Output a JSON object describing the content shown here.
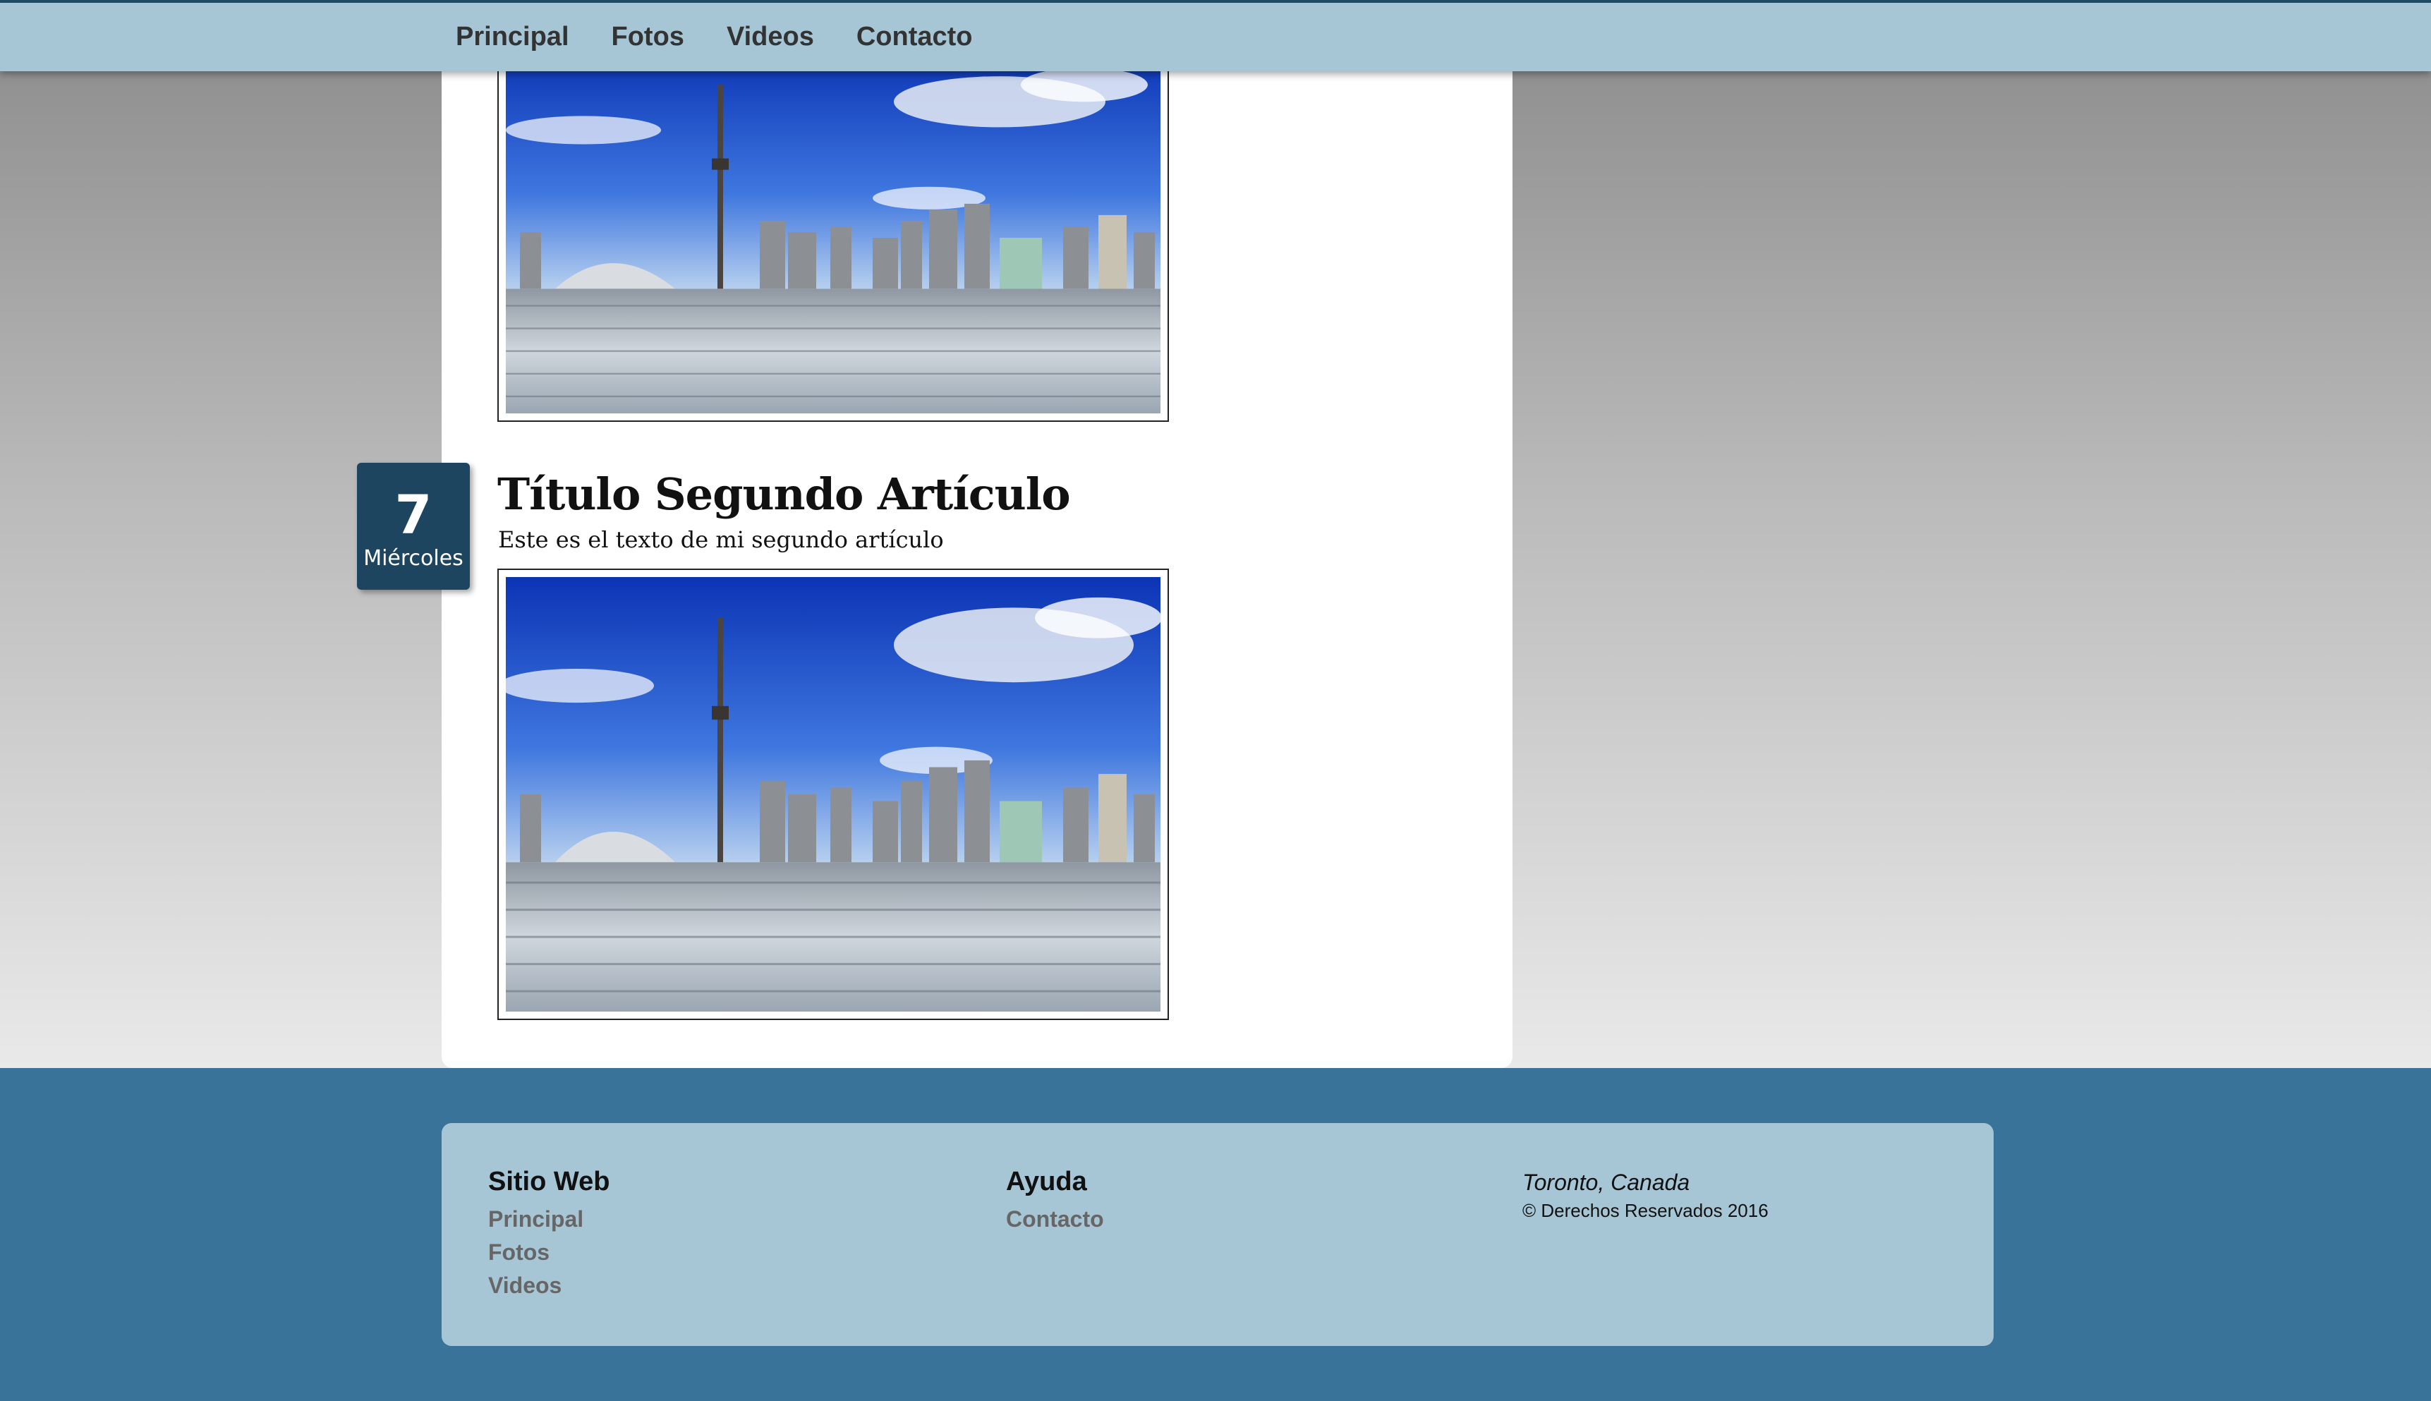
{
  "nav": {
    "items": [
      "Principal",
      "Fotos",
      "Videos",
      "Contacto"
    ]
  },
  "article": {
    "date_day": "7",
    "date_weekday": "Miércoles",
    "title": "Título Segundo Artículo",
    "text": "Este es el texto de mi segundo artículo"
  },
  "footer": {
    "col1": {
      "heading": "Sitio Web",
      "links": [
        "Principal",
        "Fotos",
        "Videos"
      ]
    },
    "col2": {
      "heading": "Ayuda",
      "links": [
        "Contacto"
      ]
    },
    "col3": {
      "location": "Toronto, Canada",
      "copyright": "© Derechos Reservados 2016"
    }
  },
  "colors": {
    "nav_bg": "#a6c6d6",
    "badge_bg": "#1e4560",
    "footer_bg": "#3a7399"
  }
}
